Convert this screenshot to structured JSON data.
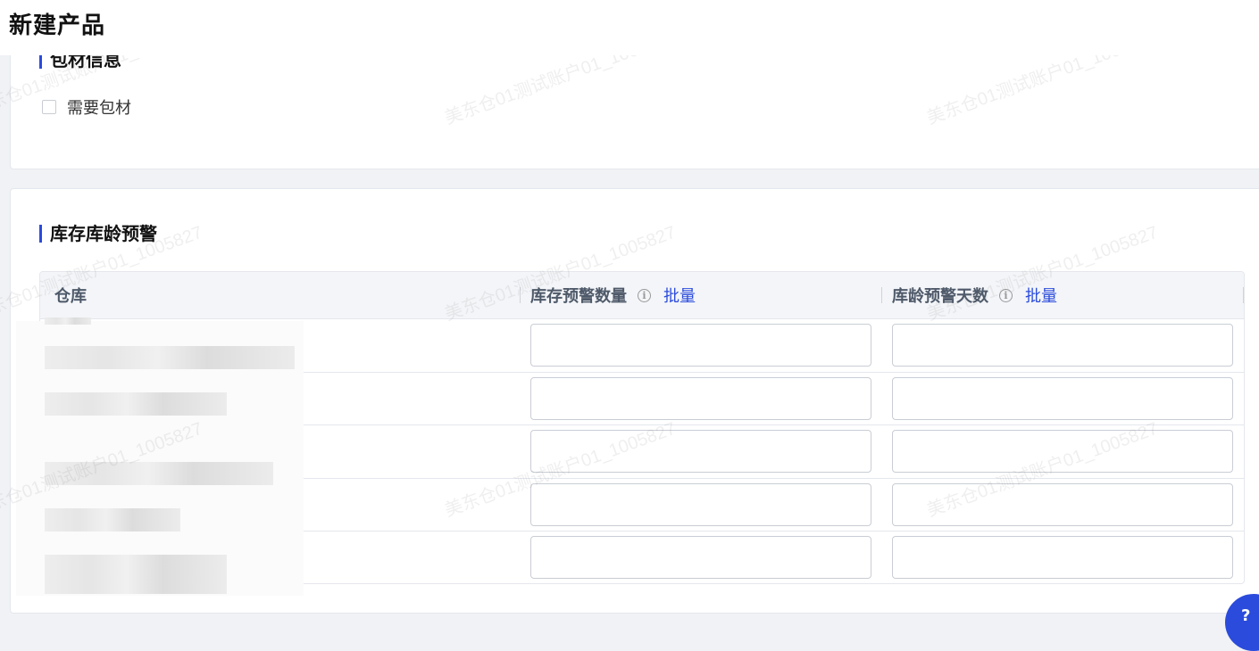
{
  "header": {
    "title": "新建产品"
  },
  "packaging": {
    "title": "包材信息",
    "checkbox_label": "需要包材",
    "checked": false
  },
  "stock_alert": {
    "title": "库存库龄预警",
    "columns": {
      "warehouse": "仓库",
      "stock_qty": "库存预警数量",
      "age_days": "库龄预警天数",
      "batch": "批量"
    },
    "rows": [
      {
        "warehouse": "",
        "stock_qty": "",
        "age_days": ""
      },
      {
        "warehouse": "",
        "stock_qty": "",
        "age_days": ""
      },
      {
        "warehouse": "",
        "stock_qty": "",
        "age_days": ""
      },
      {
        "warehouse": "",
        "stock_qty": "",
        "age_days": ""
      },
      {
        "warehouse": "",
        "stock_qty": "",
        "age_days": ""
      }
    ]
  },
  "watermark": "美东仓01测试账户01_1005827",
  "icons": {
    "info": "info-circle-icon",
    "help": "help-icon"
  },
  "colors": {
    "accent": "#2b4bdc",
    "background": "#f0f2f5"
  }
}
